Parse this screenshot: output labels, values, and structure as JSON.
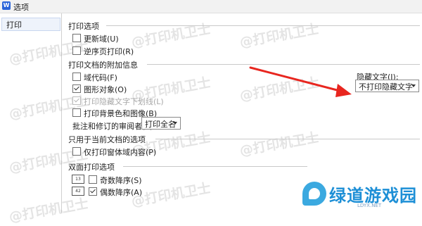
{
  "window": {
    "app_icon": "W",
    "title": "选项"
  },
  "sidebar": {
    "items": [
      {
        "label": "打印"
      }
    ]
  },
  "print_options": {
    "header": "打印选项",
    "update_fields": {
      "label": "更新域(U)",
      "checked": false
    },
    "reverse_order": {
      "label": "逆序页打印(R)",
      "checked": false
    }
  },
  "extra_info": {
    "header": "打印文档的附加信息",
    "field_codes": {
      "label": "域代码(F)",
      "checked": false
    },
    "drawing_objects": {
      "label": "图形对象(O)",
      "checked": true
    },
    "hidden_text_underline": {
      "label": "打印隐藏文字下划线(L)",
      "checked": true,
      "disabled": true
    },
    "background": {
      "label": "打印背景色和图像(B)",
      "checked": false
    },
    "reviewer_label": "批注和修订的审阅者(T):",
    "reviewer_value": "打印全名",
    "hidden_text_label": "隐藏文字(I):",
    "hidden_text_value": "不打印隐藏文字"
  },
  "current_doc": {
    "header": "只用于当前文档的选项",
    "form_data_only": {
      "label": "仅打印窗体域内容(P)",
      "checked": false
    }
  },
  "duplex": {
    "header": "双面打印选项",
    "odd_reverse": {
      "label": "奇数降序(S)",
      "checked": false,
      "icon": "13"
    },
    "even_reverse": {
      "label": "偶数降序(A)",
      "checked": true,
      "icon": "42"
    }
  },
  "watermark": {
    "text": "@打印机卫士"
  },
  "logo": {
    "text": "绿道游戏园",
    "sub": "LDYX.NET"
  },
  "colors": {
    "accent": "#2b65d9",
    "arrow": "#e8261f",
    "logo": "#1d8fd6"
  }
}
